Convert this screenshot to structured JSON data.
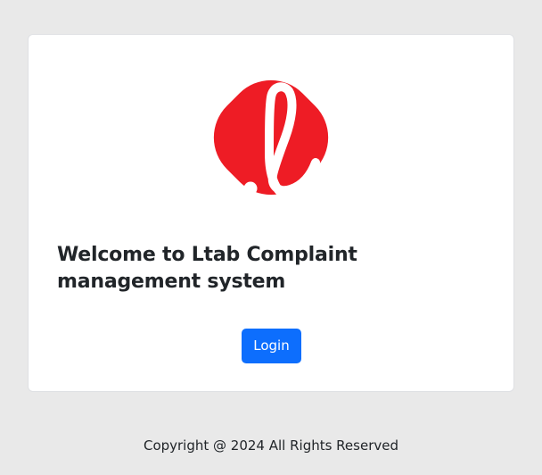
{
  "logo": {
    "icon": "ltab-logo-icon",
    "color": "#ee1c25"
  },
  "main": {
    "welcome_text": "Welcome to Ltab Complaint management system",
    "login_label": "Login"
  },
  "footer": {
    "copyright": "Copyright @ 2024 All Rights Reserved"
  },
  "colors": {
    "background": "#e9e9e9",
    "card": "#ffffff",
    "primary_button": "#0d6efd",
    "logo": "#ee1c25"
  }
}
